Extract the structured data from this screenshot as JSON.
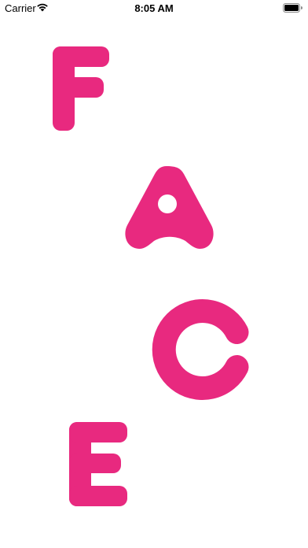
{
  "status_bar": {
    "carrier": "Carrier",
    "time": "8:05 AM",
    "icons": [
      "wifi-icon",
      "battery-icon"
    ]
  },
  "splash": {
    "letters": [
      "F",
      "A",
      "C",
      "E"
    ],
    "brand_color": "#E8297F"
  }
}
